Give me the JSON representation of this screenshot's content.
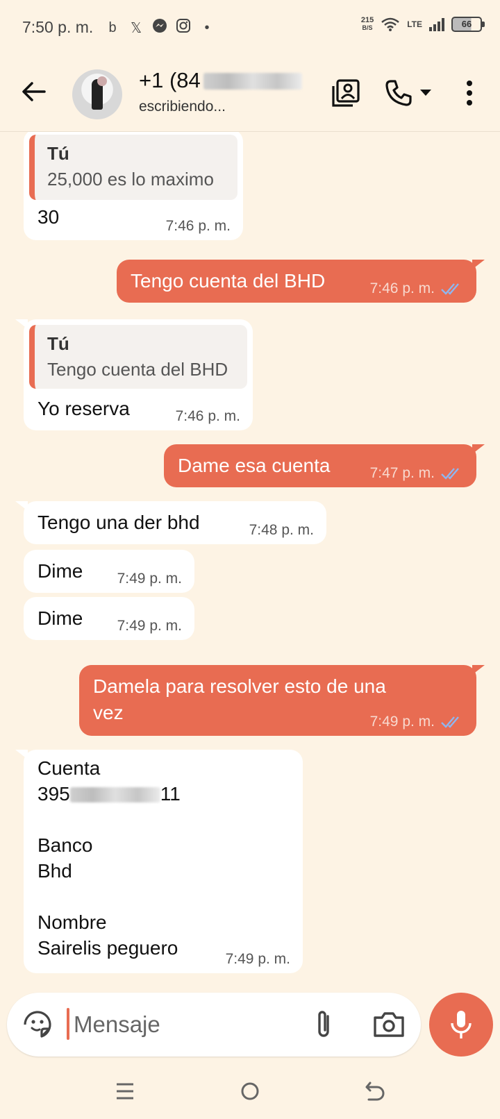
{
  "status_bar": {
    "time": "7:50 p. m.",
    "net_speed_value": "215",
    "net_speed_unit": "B/S",
    "network": "LTE",
    "battery": "66"
  },
  "header": {
    "contact_name_visible": "+1 (84",
    "contact_status": "escribiendo..."
  },
  "messages": [
    {
      "direction": "incoming",
      "quote_author": "Tú",
      "quote_text": "25,000 es lo maximo",
      "text": "30",
      "time": "7:46 p. m."
    },
    {
      "direction": "outgoing",
      "text": "Tengo cuenta del BHD",
      "time": "7:46 p. m.",
      "status": "read"
    },
    {
      "direction": "incoming",
      "quote_author": "Tú",
      "quote_text": "Tengo cuenta del BHD",
      "text": "Yo reserva",
      "time": "7:46 p. m."
    },
    {
      "direction": "outgoing",
      "text": "Dame esa cuenta",
      "time": "7:47 p. m.",
      "status": "read"
    },
    {
      "direction": "incoming",
      "text": "Tengo una der bhd",
      "time": "7:48 p. m."
    },
    {
      "direction": "incoming",
      "text": "Dime",
      "time": "7:49 p. m."
    },
    {
      "direction": "incoming",
      "text": "Dime",
      "time": "7:49 p. m."
    },
    {
      "direction": "outgoing",
      "text_line1": "Damela para resolver esto de una",
      "text_line2": "vez",
      "time": "7:49 p. m.",
      "status": "read"
    },
    {
      "direction": "incoming",
      "lines": [
        "Cuenta",
        "395",
        "11",
        "Banco",
        "Bhd",
        "Nombre",
        "Sairelis peguero"
      ],
      "time": "7:49 p. m."
    }
  ],
  "composer": {
    "placeholder": "Mensaje"
  },
  "colors": {
    "accent": "#e86c52",
    "background": "#fdf3e4",
    "incoming_bubble": "#ffffff",
    "read_ticks": "#8fb6ef"
  },
  "icons": {
    "back": "arrow-left",
    "contact_card": "contact-card",
    "call": "phone",
    "menu": "more-vertical",
    "emoji": "sticker",
    "attach": "paperclip",
    "camera": "camera",
    "mic": "microphone"
  }
}
